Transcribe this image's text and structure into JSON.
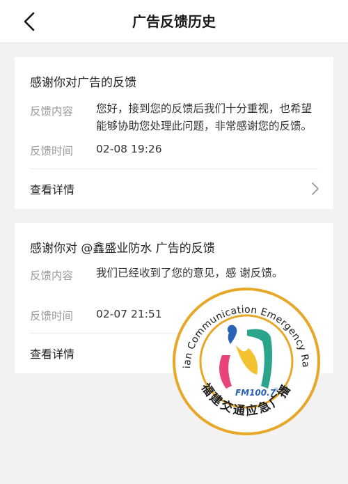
{
  "header": {
    "title": "广告反馈历史"
  },
  "icons": {
    "back": "chevron-left-icon",
    "more": "chevron-right-icon"
  },
  "feedback_items": [
    {
      "title": "感谢你对广告的反馈",
      "content_label": "反馈内容",
      "content": "您好，接到您的反馈后我们十分重视，也希望能够协助您处理此问题，非常感谢您的反馈。",
      "time_label": "反馈时间",
      "time": "02-08 19:26",
      "detail_label": "查看详情"
    },
    {
      "title": "感谢你对 @鑫盛业防水 广告的反馈",
      "content_label": "反馈内容",
      "content": "我们已经收到了您的意见，感 谢反馈。",
      "time_label": "反馈时间",
      "time": "02-07 21:51",
      "detail_label": "查看详情"
    }
  ],
  "watermark": {
    "ring_text": "Fujian Communication Emergency Radio",
    "frequency": "FM100.7",
    "cn_name": "福建交通应急广播",
    "colors": {
      "ring": "#e7a82a",
      "teal": "#2aa58c",
      "pink": "#e8437a",
      "blue": "#2a63b5",
      "yellow": "#f2c230"
    }
  }
}
